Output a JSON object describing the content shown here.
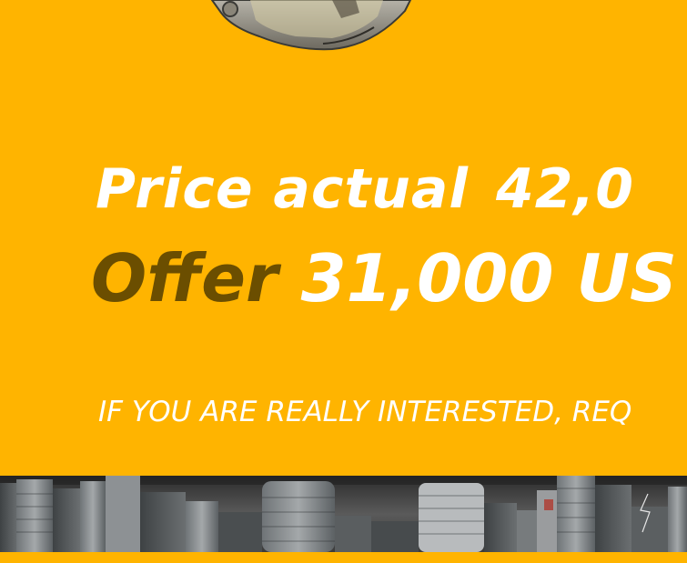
{
  "price": {
    "label": "Price actual",
    "value": "42,0"
  },
  "offer": {
    "label": "Offer",
    "value": "31,000 US"
  },
  "cta_text": "IF YOU ARE REALLY INTERESTED, REQ",
  "colors": {
    "background": "#FFB400",
    "offer_label": "#6B4E00",
    "text": "#FFFFFF"
  },
  "images": {
    "top": "excavator-bucket-image",
    "bottom": "city-skyline-image"
  }
}
